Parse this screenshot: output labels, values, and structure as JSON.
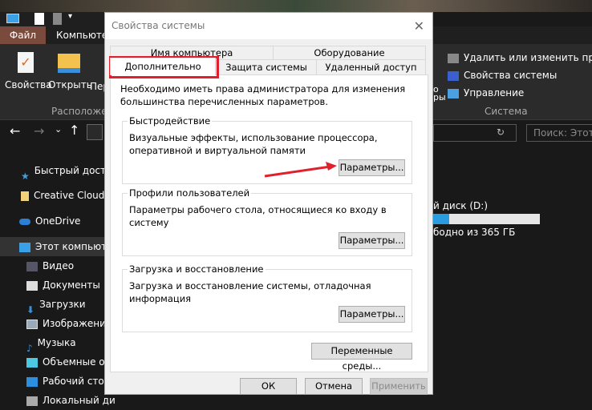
{
  "explorer": {
    "menu": {
      "file": "Файл",
      "computer": "Компьютер"
    },
    "ribbon": {
      "properties": "Свойства",
      "open": "Открыть",
      "more": "Пер",
      "location_group": "Расположение",
      "system_group": "Система",
      "system_items": [
        "Удалить или изменить програ",
        "Свойства системы",
        "Управление"
      ],
      "cut_label1": "о",
      "cut_label2": "ры"
    },
    "search_placeholder": "Поиск: Этот к",
    "sidebar": [
      "Быстрый досту",
      "Creative Cloud F",
      "OneDrive",
      "Этот компьютер",
      "Видео",
      "Документы",
      "Загрузки",
      "Изображения",
      "Музыка",
      "Объемные об",
      "Рабочий стол",
      "Локальный ди"
    ],
    "drive": {
      "name": "й диск (D:)",
      "free": "бодно из 365 ГБ",
      "used_fraction": 0.15
    }
  },
  "dialog": {
    "title": "Свойства системы",
    "tabs_row1": [
      "Имя компьютера",
      "Оборудование"
    ],
    "tabs_row2": [
      "Дополнительно",
      "Защита системы",
      "Удаленный доступ"
    ],
    "active_tab": "Дополнительно",
    "notice": "Необходимо иметь права администратора для изменения большинства перечисленных параметров.",
    "groups": [
      {
        "title": "Быстродействие",
        "text": "Визуальные эффекты, использование процессора, оперативной и виртуальной памяти",
        "button": "Параметры..."
      },
      {
        "title": "Профили пользователей",
        "text": "Параметры рабочего стола, относящиеся ко входу в систему",
        "button": "Параметры..."
      },
      {
        "title": "Загрузка и восстановление",
        "text": "Загрузка и восстановление системы, отладочная информация",
        "button": "Параметры..."
      }
    ],
    "env_button": "Переменные среды...",
    "ok": "ОК",
    "cancel": "Отмена",
    "apply": "Применить"
  },
  "annotation_color": "#e0202a"
}
